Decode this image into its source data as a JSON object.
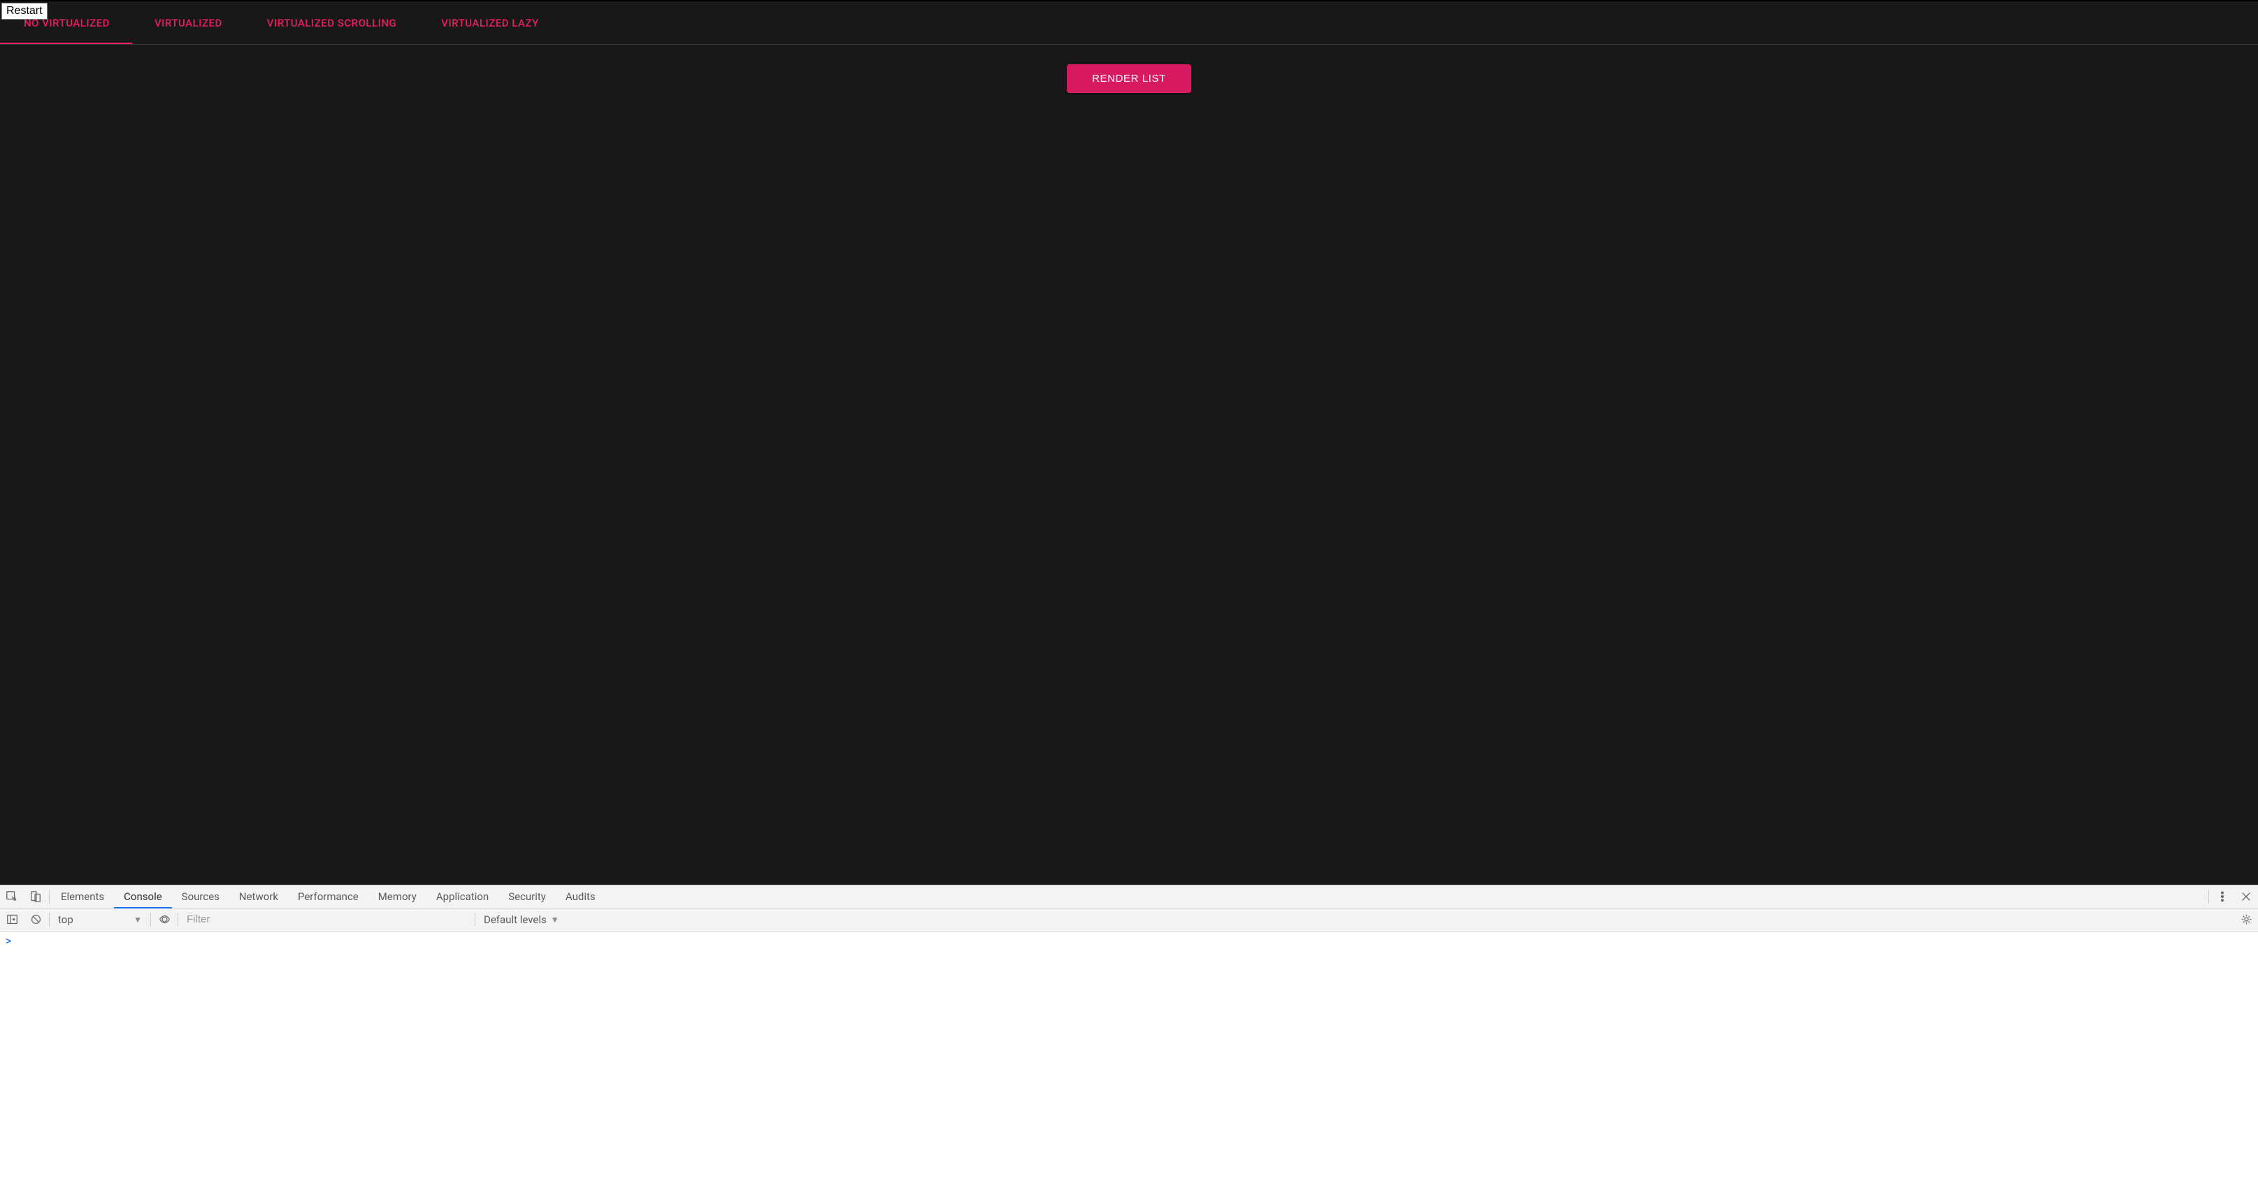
{
  "app": {
    "restart_label": "Restart",
    "tabs": [
      {
        "label": "NO VIRTUALIZED",
        "active": true
      },
      {
        "label": "VIRTUALIZED",
        "active": false
      },
      {
        "label": "VIRTUALIZED SCROLLING",
        "active": false
      },
      {
        "label": "VIRTUALIZED LAZY",
        "active": false
      }
    ],
    "render_button": "RENDER LIST"
  },
  "devtools": {
    "tabs": [
      {
        "label": "Elements",
        "active": false
      },
      {
        "label": "Console",
        "active": true
      },
      {
        "label": "Sources",
        "active": false
      },
      {
        "label": "Network",
        "active": false
      },
      {
        "label": "Performance",
        "active": false
      },
      {
        "label": "Memory",
        "active": false
      },
      {
        "label": "Application",
        "active": false
      },
      {
        "label": "Security",
        "active": false
      },
      {
        "label": "Audits",
        "active": false
      }
    ],
    "console": {
      "context": "top",
      "filter_placeholder": "Filter",
      "levels": "Default levels",
      "prompt": ">"
    }
  }
}
